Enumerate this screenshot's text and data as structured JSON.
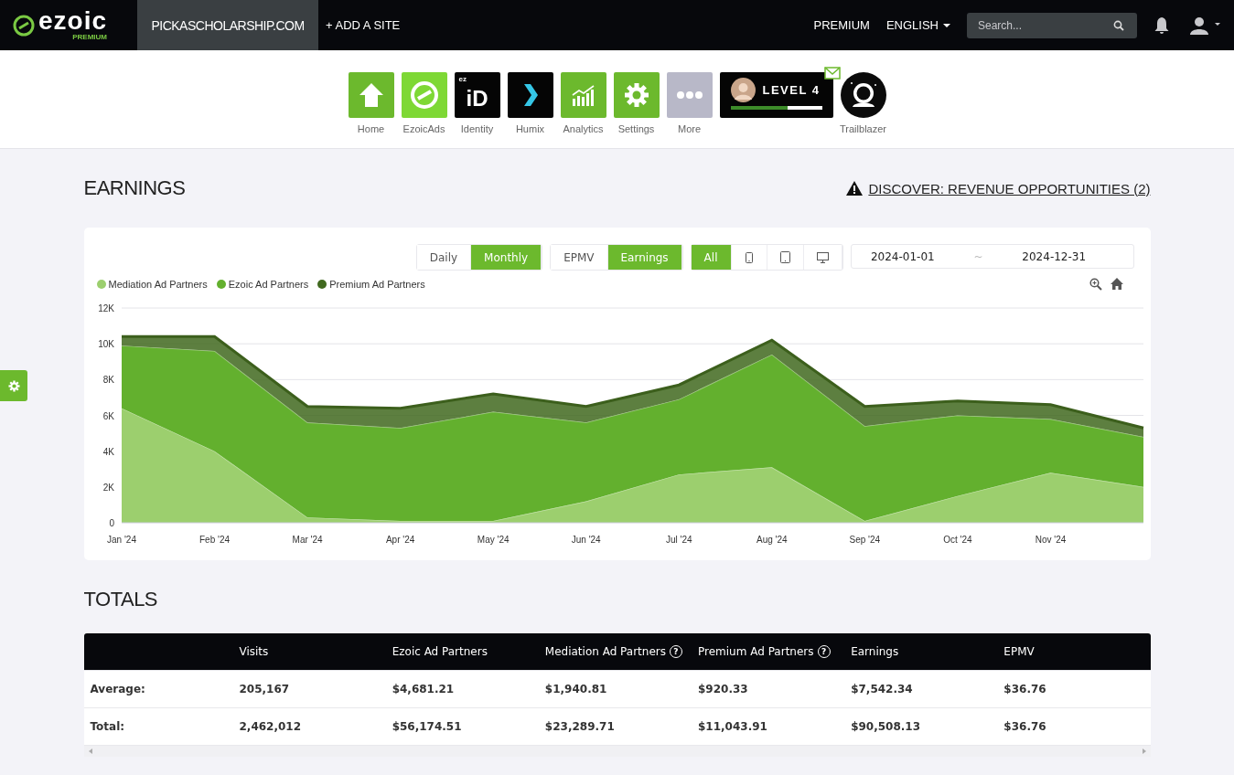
{
  "topbar": {
    "logo": "ezoic",
    "logo_badge": "PREMIUM",
    "site": "PICKASCHOLARSHIP.COM",
    "add_site": "+ ADD A SITE",
    "links": [
      "PREMIUM"
    ],
    "language": "ENGLISH",
    "search": {
      "placeholder": "Search..."
    }
  },
  "app_icons": [
    {
      "kind": "home",
      "label": "Home"
    },
    {
      "kind": "ezoicads",
      "label": "EzoicAds"
    },
    {
      "kind": "identity",
      "label": "Identity",
      "mark_small": "ez",
      "mark": "iD"
    },
    {
      "kind": "humix",
      "label": "Humix"
    },
    {
      "kind": "analytics",
      "label": "Analytics"
    },
    {
      "kind": "settings",
      "label": "Settings"
    },
    {
      "kind": "more",
      "label": "More"
    }
  ],
  "level_badge": {
    "text": "LEVEL 4",
    "level": 0.62,
    "has_message": true
  },
  "trailblazer": {
    "label": "Trailblazer"
  },
  "earnings": {
    "title": "EARNINGS",
    "discover_link": "DISCOVER: REVENUE OPPORTUNITIES (2)",
    "period_tabs": [
      {
        "label": "Daily",
        "selected": false
      },
      {
        "label": "Monthly",
        "selected": true
      }
    ],
    "metric_tabs": [
      {
        "label": "EPMV",
        "selected": false
      },
      {
        "label": "Earnings",
        "selected": true
      }
    ],
    "device_tabs": [
      {
        "kind": "all",
        "label": "All",
        "selected": true
      },
      {
        "kind": "phone",
        "selected": false
      },
      {
        "kind": "tablet",
        "selected": false
      },
      {
        "kind": "desktop",
        "selected": false
      }
    ],
    "date_range": {
      "start": "2024-01-01",
      "separator": "~",
      "end": "2024-12-31"
    },
    "chart_data": {
      "type": "area",
      "stacked": true,
      "grid": true,
      "categories": [
        "Jan '24",
        "Feb '24",
        "Mar '24",
        "Apr '24",
        "May '24",
        "Jun '24",
        "Jul '24",
        "Aug '24",
        "Sep '24",
        "Oct '24",
        "Nov '24",
        null
      ],
      "ylim": [
        0,
        12000
      ],
      "yticks": [
        {
          "value": 0,
          "label": "0"
        },
        {
          "value": 2000,
          "label": "2K"
        },
        {
          "value": 4000,
          "label": "4K"
        },
        {
          "value": 6000,
          "label": "6K"
        },
        {
          "value": 8000,
          "label": "8K"
        },
        {
          "value": 10000,
          "label": "10K"
        },
        {
          "value": 12000,
          "label": "12K"
        }
      ],
      "series": [
        {
          "name": "Mediation Ad Partners",
          "color": "#9ccf6e",
          "values": [
            6400,
            4000,
            300,
            100,
            100,
            1200,
            2700,
            3100,
            100,
            1500,
            2800,
            2000
          ]
        },
        {
          "name": "Ezoic Ad Partners",
          "color": "#63b02e",
          "values": [
            3500,
            5600,
            5300,
            5200,
            6100,
            4400,
            4200,
            6300,
            5300,
            4500,
            3000,
            2800
          ]
        },
        {
          "name": "Premium Ad Partners",
          "color": "#41691f",
          "values": [
            500,
            800,
            900,
            1100,
            1000,
            900,
            800,
            800,
            1100,
            800,
            800,
            500
          ]
        }
      ]
    }
  },
  "totals": {
    "title": "TOTALS",
    "columns": [
      {
        "label": "Visits"
      },
      {
        "label": "Ezoic Ad Partners"
      },
      {
        "label": "Mediation Ad Partners",
        "help_icon": "?"
      },
      {
        "label": "Premium Ad Partners",
        "help_icon": "?"
      },
      {
        "label": "Earnings"
      },
      {
        "label": "EPMV"
      }
    ],
    "rows": [
      {
        "label": "Average:",
        "cells": [
          "205,167",
          "$4,681.21",
          "$1,940.81",
          "$920.33",
          "$7,542.34",
          "$36.76"
        ]
      },
      {
        "label": "Total:",
        "cells": [
          "2,462,012",
          "$56,174.51",
          "$23,289.71",
          "$11,043.91",
          "$90,508.13",
          "$36.76"
        ]
      }
    ]
  }
}
